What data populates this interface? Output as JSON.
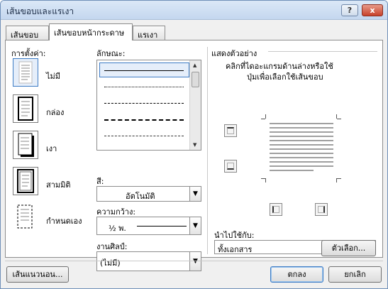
{
  "window": {
    "title": "เส้นขอบและแรเงา",
    "help_icon": "?",
    "close_icon": "x"
  },
  "tabs": [
    {
      "label": "เส้นขอบ"
    },
    {
      "label": "เส้นขอบหน้ากระดาษ"
    },
    {
      "label": "แรเงา"
    }
  ],
  "settings": {
    "heading": "การตั้งค่า:",
    "items": [
      {
        "label": "ไม่มี"
      },
      {
        "label": "กล่อง"
      },
      {
        "label": "เงา"
      },
      {
        "label": "สามมิติ"
      },
      {
        "label": "กำหนดเอง"
      }
    ]
  },
  "style": {
    "heading": "ลักษณะ:"
  },
  "color": {
    "heading": "สี:",
    "value": "อัตโนมัติ"
  },
  "width": {
    "heading": "ความกว้าง:",
    "value": "½ พ."
  },
  "art": {
    "heading": "งานศิลป์:",
    "value": "(ไม่มี)"
  },
  "preview": {
    "heading": "แสดงตัวอย่าง",
    "hint_line1": "คลิกที่ไดอะแกรมด้านล่างหรือใช้",
    "hint_line2": "ปุ่มเพื่อเลือกใช้เส้นขอบ"
  },
  "apply_to": {
    "heading": "นำไปใช้กับ:",
    "value": "ทั้งเอกสาร"
  },
  "buttons": {
    "options": "ตัวเลือก...",
    "horizontal_line": "เส้นแนวนอน...",
    "ok": "ตกลง",
    "cancel": "ยกเลิก"
  }
}
